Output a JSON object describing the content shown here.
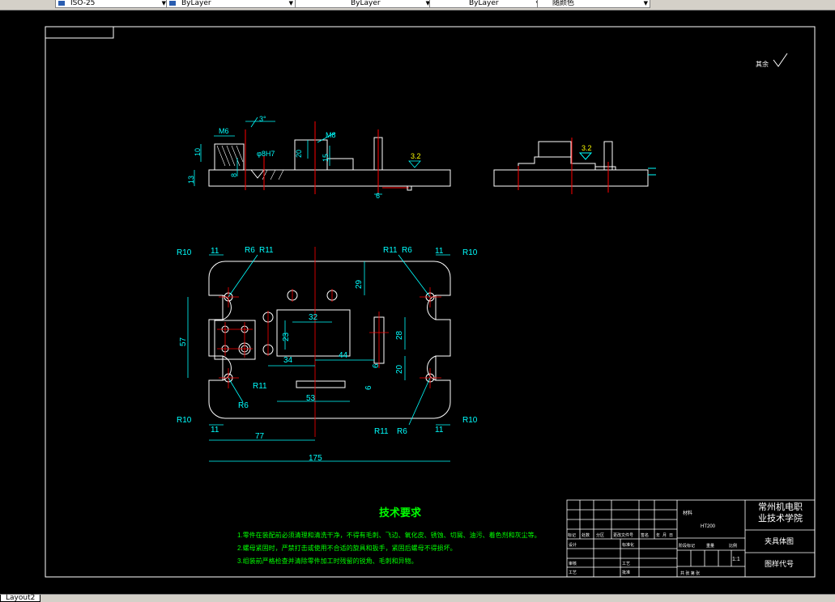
{
  "toolbar": {
    "boxes": [
      {
        "label": "ISO-25",
        "name": "dimstyle"
      },
      {
        "label": "ByLayer",
        "name": "color"
      },
      {
        "label": "ByLayer",
        "name": "linetype"
      },
      {
        "label": "ByLayer",
        "name": "lineweight"
      },
      {
        "label": "随颜色",
        "name": "plotstyle"
      }
    ]
  },
  "status": {
    "layout_tab": "Layout2"
  },
  "drawing": {
    "roughness_note": "其余",
    "dims": {
      "m6": "M6",
      "deg3": "3°",
      "m8": "M8",
      "d10": "10",
      "d8": "8",
      "d13": "13",
      "phi8h7": "φ8H7",
      "d20": "20",
      "d15": "15",
      "d6": "6",
      "ra32": "3.2",
      "r10": "R10",
      "r6": "R6",
      "r11": "R11",
      "d11": "11",
      "d29": "29",
      "d57": "57",
      "d32": "32",
      "d23": "23",
      "d34": "34",
      "d44": "44",
      "d28": "28",
      "d53": "53",
      "d77": "77",
      "d175": "175"
    },
    "tech_title": "技术要求",
    "tech_lines": [
      "1.零件在装配前必须清理和清洗干净，不得有毛刺、飞边、氧化皮、锈蚀、切屑、油污、着色剂和灰尘等。",
      "2.螺母紧固时，严禁打击或使用不合适的旋具和扳手，紧固后螺母不得损坏。",
      "3.组装前严格检查并清除零件加工时残留的锐角、毛刺和异物。"
    ],
    "title_block": {
      "school_line1": "常州机电职",
      "school_line2": "业技术学院",
      "drawing_name": "夹具体图",
      "drawing_code": "图样代号",
      "material_label": "材料",
      "material": "HT200",
      "scale": "1:1",
      "header_cells": [
        "标记",
        "处数",
        "分区",
        "更改文件号",
        "签名",
        "年",
        "月",
        "日"
      ],
      "role_rows": [
        [
          "设计",
          "标准化"
        ],
        [
          "审核",
          "工艺"
        ],
        [
          "工艺",
          "批准"
        ]
      ],
      "stage_label": "阶段标记",
      "weight_label": "重量",
      "scale_label": "比例",
      "sheets": "共   张   第   张"
    }
  }
}
